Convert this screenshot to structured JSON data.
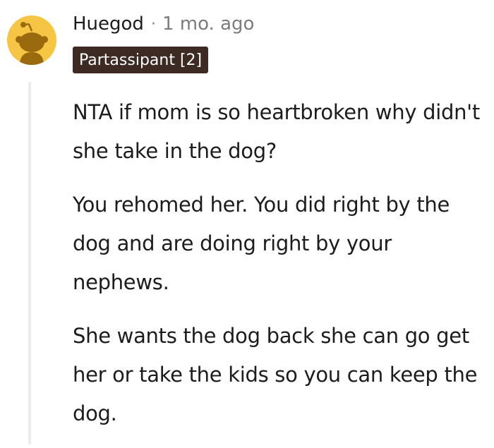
{
  "comment": {
    "author": "Huegod",
    "separator": "·",
    "timestamp": "1 mo. ago",
    "flair": "Partassipant [2]",
    "paragraphs": [
      "NTA if mom is so heartbroken why didn't she take in the dog?",
      "You rehomed her. You did right by the dog and are doing right by your nephews.",
      "She wants the dog back she can go get her or take the kids so you can keep the dog."
    ],
    "avatar_icon": "reddit-snoo-icon"
  },
  "colors": {
    "avatar_bg": "#f6c543",
    "avatar_figure": "#9a6a0e",
    "flair_bg": "#3d2a22",
    "flair_text": "#ffffff",
    "meta_text": "#7c7c7c",
    "body_text": "#1c1c1c",
    "thread_line": "#ececec"
  }
}
